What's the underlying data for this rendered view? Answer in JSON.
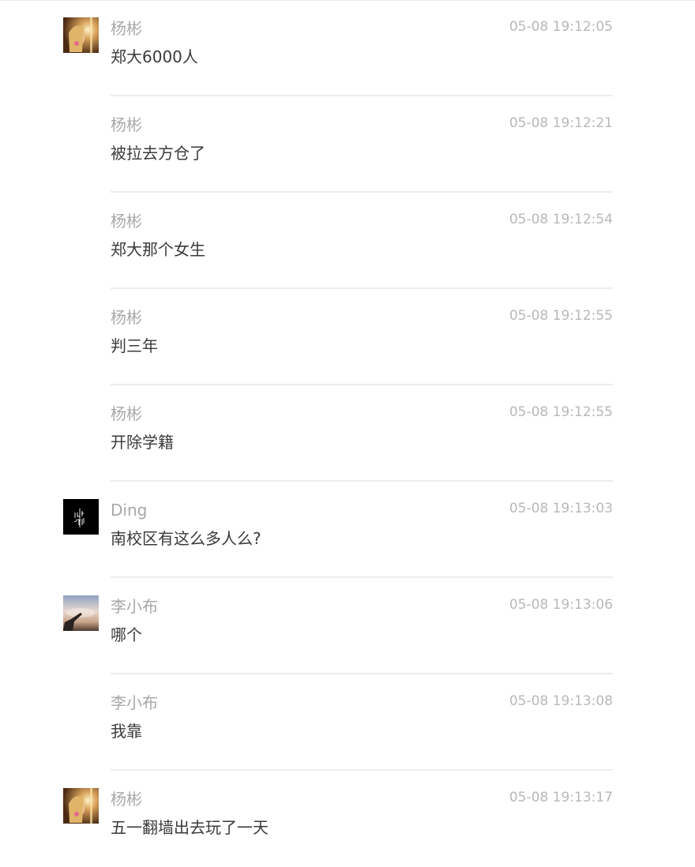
{
  "messages": [
    {
      "sender": "杨彬",
      "time": "05-08 19:12:05",
      "text": "郑大6000人",
      "avatar": "yangbin-avatar"
    },
    {
      "sender": "杨彬",
      "time": "05-08 19:12:21",
      "text": "被拉去方仓了",
      "avatar": null
    },
    {
      "sender": "杨彬",
      "time": "05-08 19:12:54",
      "text": "郑大那个女生",
      "avatar": null
    },
    {
      "sender": "杨彬",
      "time": "05-08 19:12:55",
      "text": "判三年",
      "avatar": null
    },
    {
      "sender": "杨彬",
      "time": "05-08 19:12:55",
      "text": "开除学籍",
      "avatar": null
    },
    {
      "sender": "Ding",
      "time": "05-08 19:13:03",
      "text": "南校区有这么多人么?",
      "avatar": "ding-avatar"
    },
    {
      "sender": "李小布",
      "time": "05-08 19:13:06",
      "text": "哪个",
      "avatar": "lixiaobu-avatar"
    },
    {
      "sender": "李小布",
      "time": "05-08 19:13:08",
      "text": "我靠",
      "avatar": null
    },
    {
      "sender": "杨彬",
      "time": "05-08 19:13:17",
      "text": "五一翻墙出去玩了一天",
      "avatar": "yangbin-avatar"
    }
  ],
  "colors": {
    "sender": "#a8a8a8",
    "time": "#b8b8b8",
    "text": "#3a3a3a",
    "divider": "#ececec"
  }
}
